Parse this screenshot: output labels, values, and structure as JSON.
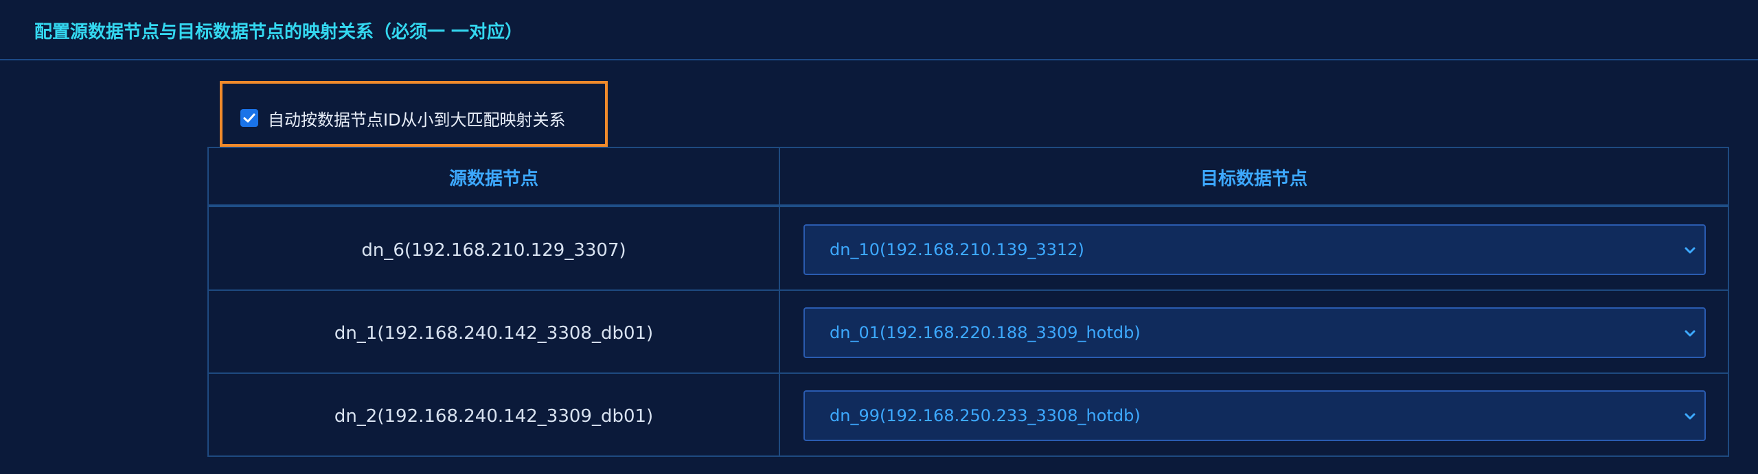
{
  "header": {
    "title": "配置源数据节点与目标数据节点的映射关系（必须一 一对应）"
  },
  "auto_match": {
    "checked": true,
    "label": "自动按数据节点ID从小到大匹配映射关系"
  },
  "table": {
    "columns": [
      "源数据节点",
      "目标数据节点"
    ],
    "rows": [
      {
        "source": "dn_6(192.168.210.129_3307)",
        "target": "dn_10(192.168.210.139_3312)"
      },
      {
        "source": "dn_1(192.168.240.142_3308_db01)",
        "target": "dn_01(192.168.220.188_3309_hotdb)"
      },
      {
        "source": "dn_2(192.168.240.142_3309_db01)",
        "target": "dn_99(192.168.250.233_3308_hotdb)"
      }
    ]
  },
  "colors": {
    "background": "#0b1a3a",
    "title": "#34d8f0",
    "accent_blue": "#3da9ff",
    "highlight_border": "#f08a2b",
    "checkbox": "#1a73e8"
  },
  "icons": {
    "checkbox": "checkmark-icon",
    "dropdown": "chevron-down-icon"
  }
}
